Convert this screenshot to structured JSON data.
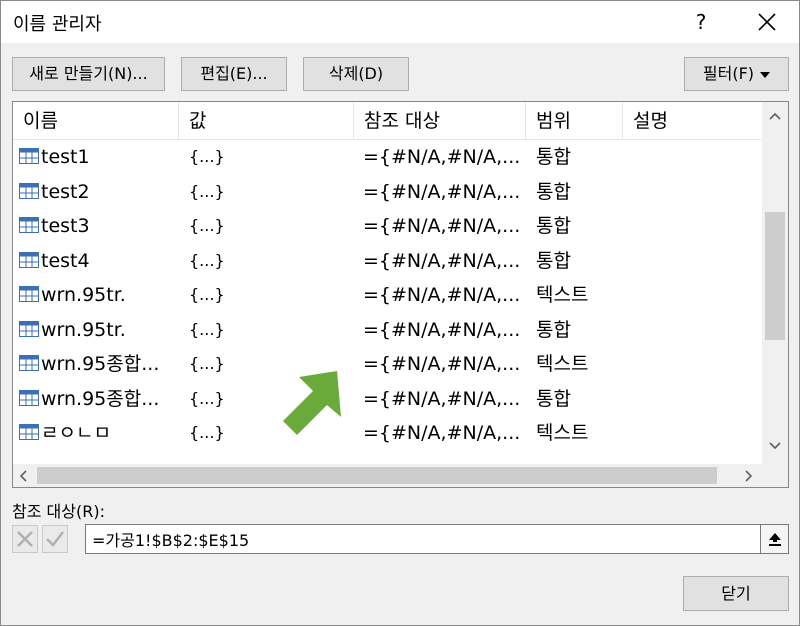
{
  "window": {
    "title": "이름 관리자",
    "help": "?"
  },
  "toolbar": {
    "new_label": "새로 만들기(N)...",
    "edit_label": "편집(E)...",
    "delete_label": "삭제(D)",
    "filter_label": "필터(F)"
  },
  "list": {
    "columns": [
      "이름",
      "값",
      "참조 대상",
      "범위",
      "설명"
    ],
    "rows": [
      {
        "name": "test1",
        "value": "{...}",
        "ref": "={#N/A,#N/A,...",
        "scope": "통합",
        "desc": ""
      },
      {
        "name": "test2",
        "value": "{...}",
        "ref": "={#N/A,#N/A,...",
        "scope": "통합",
        "desc": ""
      },
      {
        "name": "test3",
        "value": "{...}",
        "ref": "={#N/A,#N/A,...",
        "scope": "통합",
        "desc": ""
      },
      {
        "name": "test4",
        "value": "{...}",
        "ref": "={#N/A,#N/A,...",
        "scope": "통합",
        "desc": ""
      },
      {
        "name": "wrn.95tr.",
        "value": "{...}",
        "ref": "={#N/A,#N/A,...",
        "scope": "텍스트",
        "desc": ""
      },
      {
        "name": "wrn.95tr.",
        "value": "{...}",
        "ref": "={#N/A,#N/A,...",
        "scope": "통합",
        "desc": ""
      },
      {
        "name": "wrn.95종합...",
        "value": "{...}",
        "ref": "={#N/A,#N/A,...",
        "scope": "텍스트",
        "desc": ""
      },
      {
        "name": "wrn.95종합...",
        "value": "{...}",
        "ref": "={#N/A,#N/A,...",
        "scope": "통합",
        "desc": ""
      },
      {
        "name": "ㄹㅇㄴㅁ",
        "value": "{...}",
        "ref": "={#N/A,#N/A,...",
        "scope": "텍스트",
        "desc": ""
      }
    ]
  },
  "refers_to": {
    "label": "참조 대상(R):",
    "value": "=가공1!$B$2:$E$15"
  },
  "footer": {
    "close_label": "닫기"
  },
  "colors": {
    "arrow": "#6aaa3a",
    "table_icon": "#3b6fb6"
  },
  "icons": [
    "close-icon",
    "table-icon",
    "collapse-dialog-icon",
    "cancel-x-icon",
    "enter-check-icon"
  ]
}
